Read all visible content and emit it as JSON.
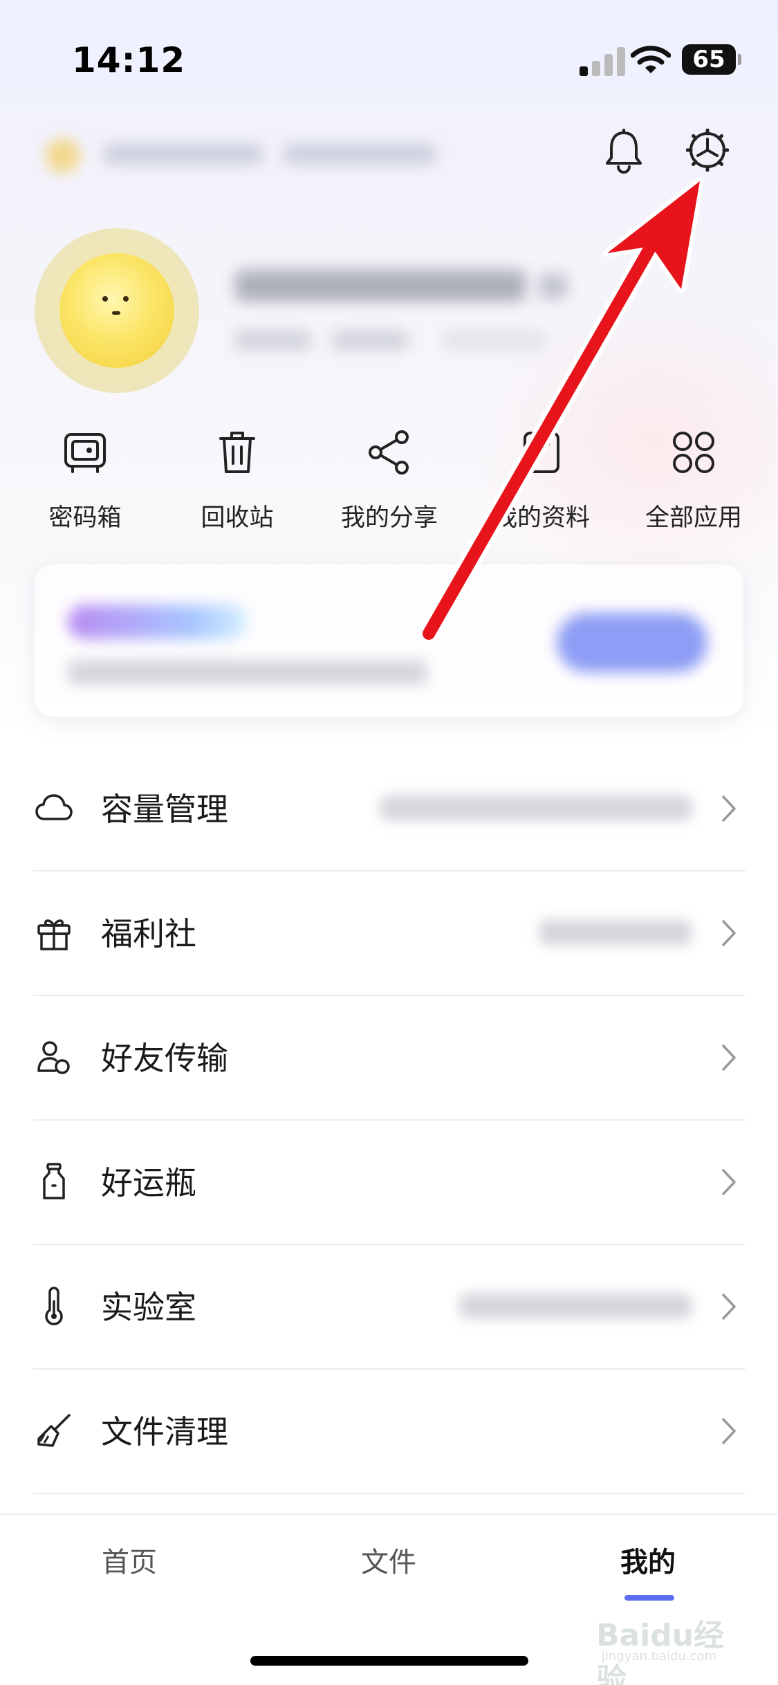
{
  "status_bar": {
    "time": "14:12",
    "battery": "65"
  },
  "header": {
    "bell_icon": "bell-icon",
    "settings_icon": "gear-icon"
  },
  "quick_actions": [
    {
      "label": "密码箱",
      "icon": "safe-icon"
    },
    {
      "label": "回收站",
      "icon": "trash-icon"
    },
    {
      "label": "我的分享",
      "icon": "share-icon"
    },
    {
      "label": "我的资料",
      "icon": "folder-icon"
    },
    {
      "label": "全部应用",
      "icon": "apps-grid-icon"
    }
  ],
  "menu": [
    {
      "label": "容量管理",
      "icon": "cloud-icon"
    },
    {
      "label": "福利社",
      "icon": "gift-icon"
    },
    {
      "label": "好友传输",
      "icon": "friend-transfer-icon"
    },
    {
      "label": "好运瓶",
      "icon": "bottle-icon"
    },
    {
      "label": "实验室",
      "icon": "thermometer-icon"
    },
    {
      "label": "文件清理",
      "icon": "broom-icon"
    }
  ],
  "tabs": [
    {
      "label": "首页",
      "active": false
    },
    {
      "label": "文件",
      "active": false
    },
    {
      "label": "我的",
      "active": true
    }
  ],
  "watermark": {
    "text": "Baidu经验",
    "sub": "jingyan.baidu.com"
  },
  "colors": {
    "accent": "#5b6df2",
    "arrow": "#e8141b"
  }
}
